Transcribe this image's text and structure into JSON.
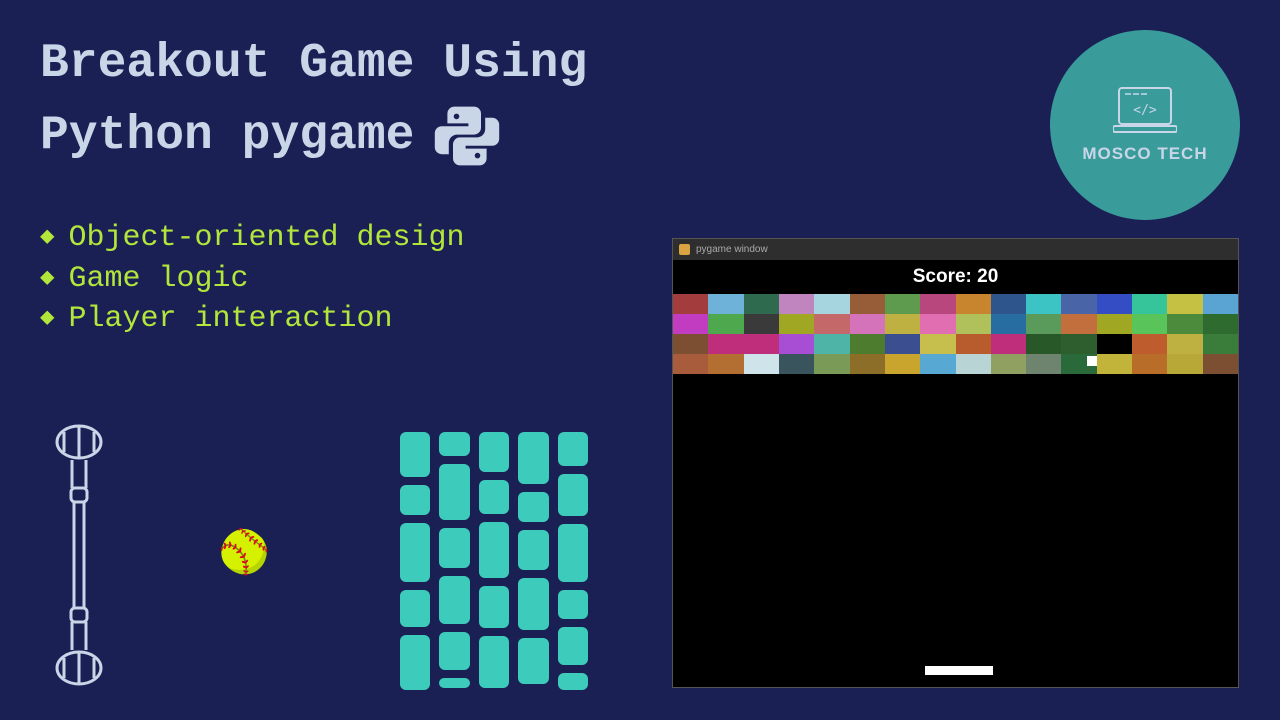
{
  "title": {
    "line1": "Breakout Game Using",
    "line2": "Python pygame"
  },
  "logo": {
    "text": "MOSCO TECH"
  },
  "bullets": [
    "Object-oriented design",
    "Game logic",
    "Player interaction"
  ],
  "game": {
    "window_title": "pygame window",
    "score_label": "Score: 20",
    "rows": [
      [
        "#a33c3c",
        "#6fb2d9",
        "#2e6b4e",
        "#c085bf",
        "#a6d5e0",
        "#975d38",
        "#5e9b4e",
        "#b7477c",
        "#c9852e",
        "#2e568c",
        "#3cc4c4",
        "#4a64a8",
        "#344dc4",
        "#36c49a",
        "#c5c142",
        "#5aa4d4"
      ],
      [
        "#c23cc2",
        "#4ea84e",
        "#3a3a3a",
        "#a0a823",
        "#c5686a",
        "#d473ba",
        "#bfb141",
        "#e06eb0",
        "#b0c05a",
        "#276da1",
        "#5a9a5a",
        "#c26e3d",
        "#a0a823",
        "#59c459",
        "#4c8a3c",
        "#2e6b2e"
      ],
      [
        "#7c4e32",
        "#bf2e7a",
        "#bf2e7a",
        "#a84ed4",
        "#4eb4a8",
        "#4e7c2e",
        "#3a4e90",
        "#c6bf4e",
        "#b85c2e",
        "#bf2e7a",
        "#285828",
        "#2e5e2e",
        "#000000",
        "#bf5c2e",
        "#bfb141",
        "#3a7c3a"
      ],
      [
        "#a85c3c",
        "#b36e32",
        "#cfe3ea",
        "#3a545e",
        "#7a9a58",
        "#8c6e28",
        "#c9a52e",
        "#58a8d4",
        "#b8d4d4",
        "#90a060",
        "#6e846e",
        "#2a6a3a",
        "#c2b43a",
        "#b86e28",
        "#b8a838",
        "#7c4e32"
      ]
    ]
  },
  "ball_emoji": "🥎",
  "brick_columns": [
    [
      46,
      30,
      60,
      38,
      56
    ],
    [
      24,
      56,
      40,
      48,
      38,
      10
    ],
    [
      40,
      34,
      56,
      42,
      52
    ],
    [
      52,
      30,
      40,
      52,
      46
    ],
    [
      36,
      44,
      60,
      30,
      40,
      18
    ]
  ]
}
